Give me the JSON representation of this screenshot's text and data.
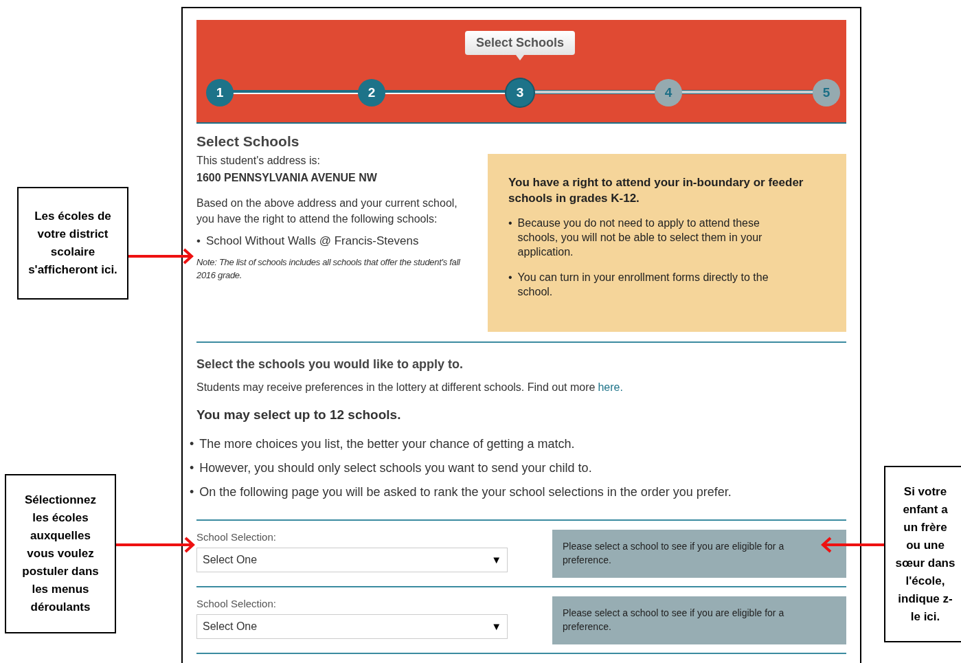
{
  "stepper": {
    "tooltip": "Select Schools",
    "steps": [
      {
        "label": "1",
        "completed": true,
        "selected": false
      },
      {
        "label": "2",
        "completed": true,
        "selected": false
      },
      {
        "label": "3",
        "completed": true,
        "selected": true
      },
      {
        "label": "4",
        "completed": false,
        "selected": false
      },
      {
        "label": "5",
        "completed": false,
        "selected": false
      }
    ]
  },
  "bullet": "•",
  "address_section": {
    "title": "Select Schools",
    "address_label": "This student's address is:",
    "address": "1600 PENNSYLVANIA AVENUE NW",
    "intro": "Based on the above address and your current school, you have the right to attend the following schools:",
    "schools": [
      "School Without Walls @ Francis-Stevens"
    ],
    "note": "Note: The list of schools includes all schools that offer the student's fall 2016 grade."
  },
  "rights_box": {
    "title": "You have a right to attend your in-boundary or feeder schools in grades K-12.",
    "items": [
      "Because you do not need to apply to attend these schools, you will not be able to select them in your application.",
      "You can turn in your enrollment forms directly to the school."
    ]
  },
  "apply_section": {
    "title": "Select the schools you would like to apply to.",
    "info": "Students may receive preferences in the lottery at different schools. Find out more",
    "link": "here.",
    "limit": "You may select up to 12 schools.",
    "items": [
      "The more choices you list, the better your chance of getting a match.",
      "However, you should only select schools you want to send your child to.",
      "On the following page you will be asked to rank the your school selections in the order you prefer."
    ]
  },
  "selections": [
    {
      "label": "School Selection:",
      "value": "Select One",
      "arrow": "▼",
      "message": "Please select a school to see if you are eligible for a preference."
    },
    {
      "label": "School Selection:",
      "value": "Select One",
      "arrow": "▼",
      "message": "Please select a school to see if you are eligible for a preference."
    }
  ],
  "annotations": [
    {
      "text": "Les écoles de votre district scolaire s'afficheront ici."
    },
    {
      "text": "Sélectionnez les écoles auxquelles vous voulez postuler dans les menus déroulants"
    },
    {
      "text": "Si votre enfant a un frère ou une sœur dans l'école, indique z-le ici."
    }
  ]
}
